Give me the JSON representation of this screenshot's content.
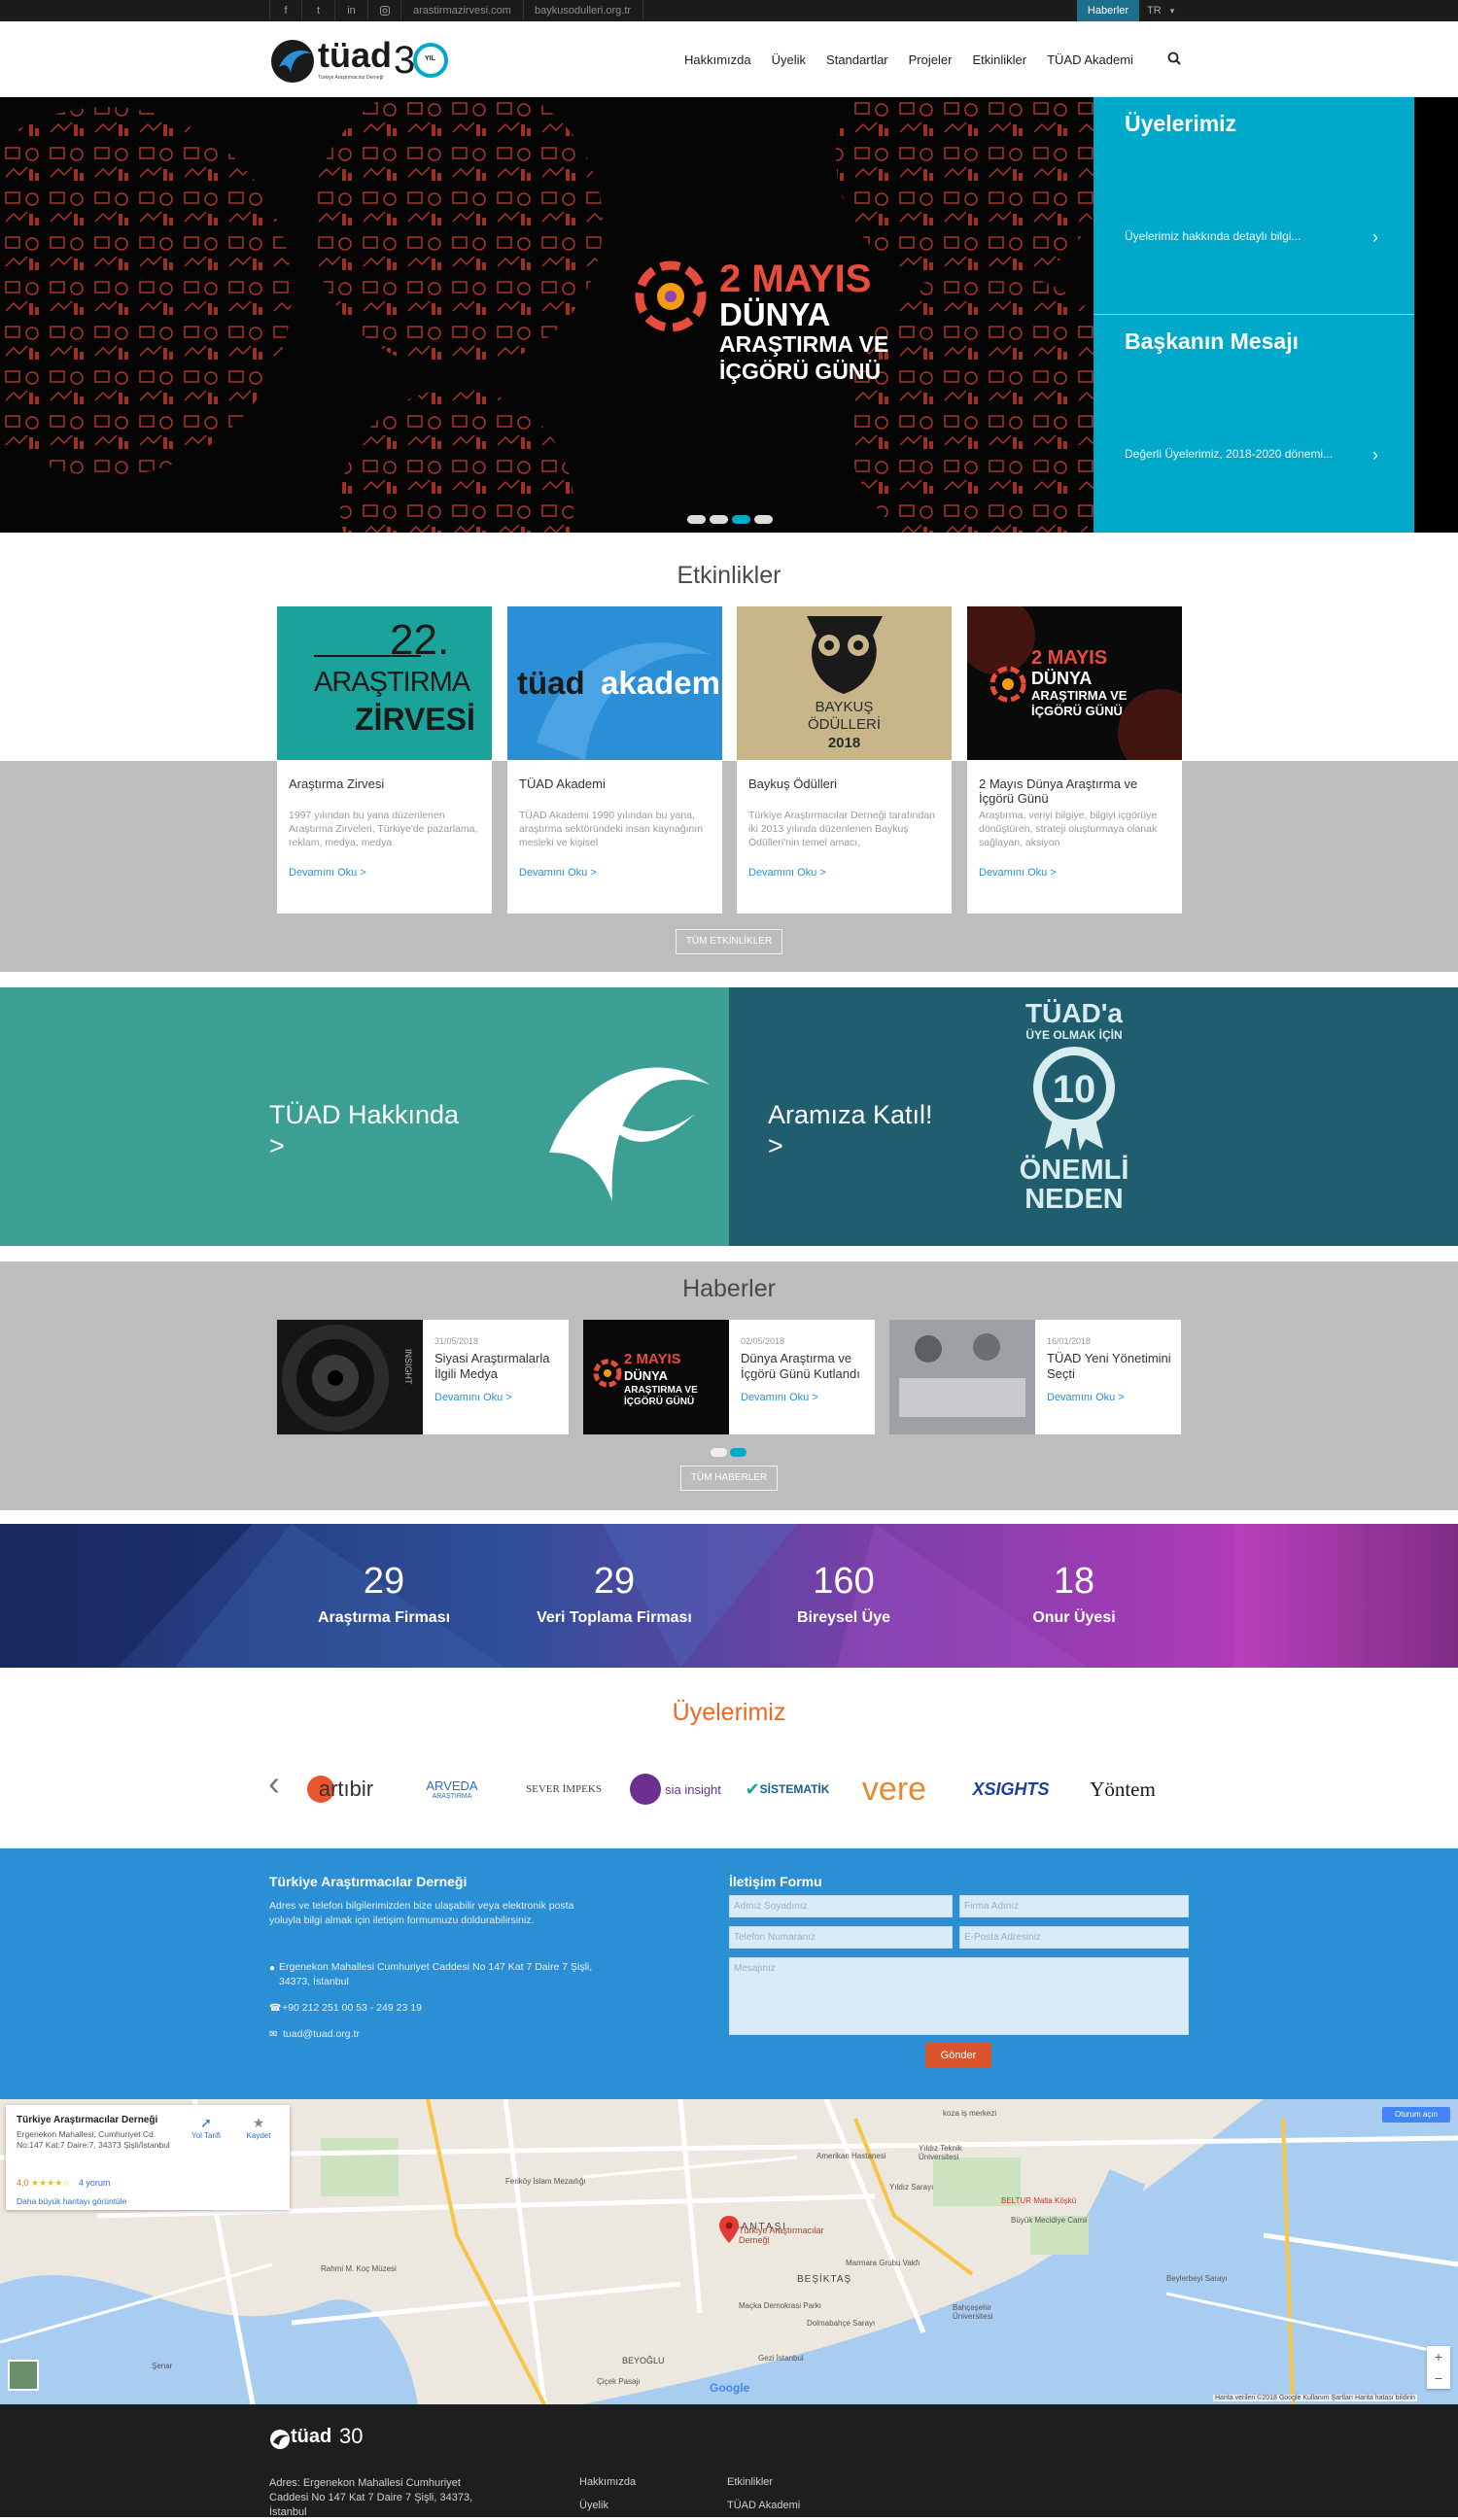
{
  "topbar": {
    "social": [
      "f",
      "t",
      "in",
      "ig"
    ],
    "links": [
      "arastirmazirvesi.com",
      "baykusodulleri.org.tr"
    ],
    "news_button": "Haberler",
    "language": "TR"
  },
  "header": {
    "logo_text": "tüad",
    "logo_anniversary": "30",
    "logo_year_suffix": "YIL",
    "logo_subtitle": "Türkiye Araştırmacılar Derneği",
    "nav": [
      "Hakkımızda",
      "Üyelik",
      "Standartlar",
      "Projeler",
      "Etkinlikler",
      "TÜAD Akademi"
    ]
  },
  "hero": {
    "banner_lines": [
      "2 MAYIS",
      "DÜNYA",
      "ARAŞTIRMA VE",
      "İÇGÖRÜ GÜNÜ"
    ],
    "side_panels": [
      {
        "title": "Üyelerimiz",
        "text": "Üyelerimiz hakkında detaylı bilgi..."
      },
      {
        "title": "Başkanın Mesajı",
        "text": "Değerli Üyelerimiz, 2018-2020 dönemi..."
      }
    ],
    "slide_count": 4,
    "active_slide": 3
  },
  "events": {
    "title": "Etkinlikler",
    "more_label": "TÜM ETKİNLİKLER",
    "items": [
      {
        "title": "Araştırma Zirvesi",
        "text": "1997 yılından bu yana düzenlenen Araştırma Zirveleri, Türkiye'de pazarlama, reklam, medya, medya",
        "more": "Devamını Oku >",
        "img_lines": [
          "22.",
          "ARAŞTIRMA",
          "ZİRVESİ"
        ]
      },
      {
        "title": "TÜAD Akademi",
        "text": "TÜAD Akademi 1990 yılından bu yana, araştırma sektöründeki insan kaynağının mesleki ve kişisel",
        "more": "Devamını Oku >",
        "img_lines": [
          "tüad",
          "akademi"
        ]
      },
      {
        "title": "Baykuş Ödülleri",
        "text": "Türkiye Araştırmacılar Derneği tarafından iki 2013 yılında düzenlenen Baykuş Ödülleri'nin temel amacı,",
        "more": "Devamını Oku >",
        "img_lines": [
          "BAYKUŞ",
          "ÖDÜLLERİ",
          "2018"
        ]
      },
      {
        "title": "2 Mayıs Dünya Araştırma ve İçgörü Günü",
        "text": "Araştırma, veriyi bilgiye, bilgiyi içgörüye dönüştüren, strateji oluşturmaya olanak sağlayan, aksiyon",
        "more": "Devamını Oku >",
        "img_lines": [
          "2 MAYIS",
          "DÜNYA",
          "ARAŞTIRMA VE",
          "İÇGÖRÜ GÜNÜ"
        ]
      }
    ]
  },
  "about": {
    "label": "TÜAD Hakkında",
    "arrow": ">"
  },
  "join": {
    "label": "Aramıza Katıl!",
    "arrow": ">",
    "badge_lines": [
      "TÜAD'a",
      "ÜYE OLMAK İÇİN",
      "10",
      "ÖNEMLİ",
      "NEDEN"
    ]
  },
  "news": {
    "title": "Haberler",
    "more_label": "TÜM HABERLER",
    "items": [
      {
        "date": "31/05/2018",
        "title": "Siyasi Araştırmalarla İlgili Medya",
        "more": "Devamını Oku >"
      },
      {
        "date": "02/05/2018",
        "title": "Dünya Araştırma ve İçgörü Günü Kutlandı",
        "more": "Devamını Oku >"
      },
      {
        "date": "16/01/2018",
        "title": "TÜAD Yeni Yönetimini Seçti",
        "more": "Devamını Oku >"
      }
    ],
    "img_texts": [
      "INSIGHT",
      "2 MAYIS",
      "DÜNYA",
      "ARAŞTIRMA VE",
      "İÇGÖRÜ GÜNÜ"
    ],
    "dot_count": 2,
    "active_dot": 2
  },
  "stats": [
    {
      "value": "29",
      "label": "Araştırma Firması"
    },
    {
      "value": "29",
      "label": "Veri Toplama Firması"
    },
    {
      "value": "160",
      "label": "Bireysel Üye"
    },
    {
      "value": "18",
      "label": "Onur Üyesi"
    }
  ],
  "members": {
    "title": "Üyelerimiz",
    "prev_arrow": "‹",
    "logos": [
      "artıbir",
      "ARVEDA",
      "ARAŞTIRMA",
      "SEVER İMPEKS",
      "sia insight",
      "SİSTEMATİK",
      "vere",
      "XSIGHTS",
      "Yöntem"
    ]
  },
  "contact": {
    "org_title": "Türkiye Araştırmacılar Derneği",
    "intro": "Adres ve telefon bilgilerimizden bize ulaşabilir veya elektronik posta yoluyla bilgi almak için iletişim formumuzu doldurabilirsiniz.",
    "address": "Ergenekon Mahallesi Cumhuriyet Caddesi No 147 Kat 7 Daire 7 Şişli, 34373, İstanbul",
    "phone": "+90 212 251 00 53 - 249 23 19",
    "email": "tuad@tuad.org.tr",
    "form_title": "İletişim Formu",
    "fields": {
      "name": "Adınız Soyadınız",
      "company": "Firma Adınız",
      "phone": "Telefon Numaranız",
      "email": "E-Posta Adresiniz",
      "message": "Mesajınız"
    },
    "send_label": "Gönder"
  },
  "map": {
    "card_title": "Türkiye Araştırmacılar Derneği",
    "card_address": "Ergenekon Mahallesi, Cumhuriyet Cd. No:147 Kat:7 Daire:7, 34373 Şişli/İstanbul",
    "rating": "4,0",
    "stars": "★★★★☆",
    "reviews": "4 yorum",
    "directions": "Yol Tarifi",
    "save": "Kaydet",
    "larger_map": "Daha büyük haritayı görüntüle",
    "sign_in": "Oturum açın",
    "place_label": "Türkiye Araştırmacılar Derneği",
    "places": [
      "koza iş merkezi",
      "Amerikan Hastanesi",
      "Yıldız Teknik Üniversitesi",
      "Feriköy İslam Mezarlığı",
      "Yıldız Sarayı",
      "BELTUR Malta Köşkü",
      "Büyük Mecidiye Camii",
      "NİŞANTAŞI",
      "Marmara Grubu Vakfı",
      "Beylerbeyi Sarayı",
      "BEŞİKTAŞ",
      "Bahçeşehir Üniversitesi",
      "Maçka Demokrasi Parkı",
      "Dolmabahçe Sarayı",
      "Rahmi M. Koç Müzesi",
      "BEYOĞLU",
      "Gezi İstanbul",
      "Çiçek Pasajı",
      "Şenar"
    ],
    "google": "Google",
    "attribution": "Harita verileri ©2018 Google   Kullanım Şartları   Harita hatası bildirin",
    "zoom_in": "+",
    "zoom_out": "−"
  },
  "footer": {
    "logo_text": "tüad",
    "logo_anniversary": "30",
    "address": "Adres: Ergenekon Mahallesi Cumhuriyet Caddesi No 147 Kat 7 Daire 7 Şişli, 34373, İstanbul",
    "links_col1": [
      "Hakkımızda",
      "Üyelik"
    ],
    "links_col2": [
      "Etkinlikler",
      "TÜAD Akademi"
    ]
  },
  "colors": {
    "accent": "#00a9c9",
    "link": "#2a8fd6",
    "orange": "#f26522",
    "contact_bg": "#2b8fd6"
  }
}
